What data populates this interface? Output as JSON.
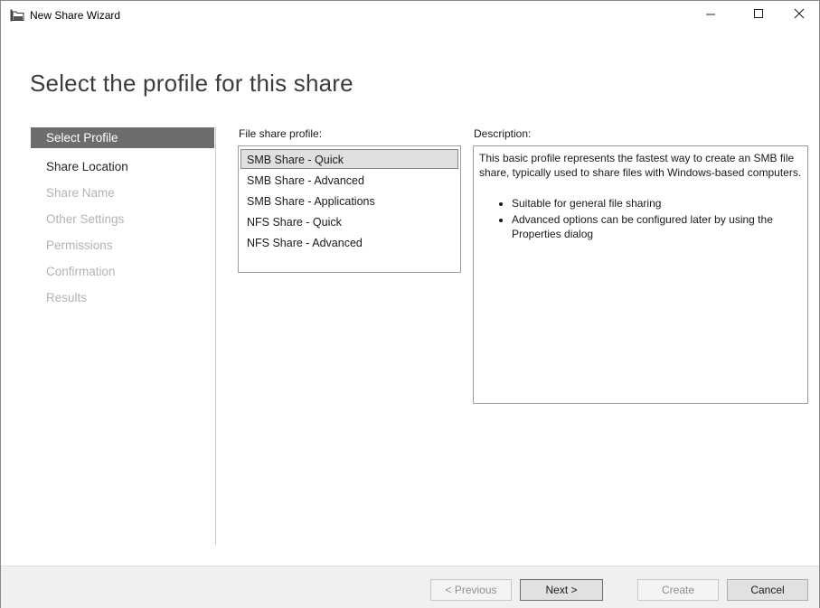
{
  "window": {
    "title": "New Share Wizard",
    "icons": {
      "app": "share-folder-icon",
      "minimize": "minimize-icon",
      "maximize": "maximize-icon",
      "close": "close-icon"
    }
  },
  "page": {
    "title": "Select the profile for this share"
  },
  "nav": {
    "items": [
      {
        "label": "Select Profile",
        "state": "active"
      },
      {
        "label": "Share Location",
        "state": "enabled"
      },
      {
        "label": "Share Name",
        "state": "disabled"
      },
      {
        "label": "Other Settings",
        "state": "disabled"
      },
      {
        "label": "Permissions",
        "state": "disabled"
      },
      {
        "label": "Confirmation",
        "state": "disabled"
      },
      {
        "label": "Results",
        "state": "disabled"
      }
    ]
  },
  "profile": {
    "label": "File share profile:",
    "items": [
      {
        "label": "SMB Share - Quick",
        "selected": true
      },
      {
        "label": "SMB Share - Advanced",
        "selected": false
      },
      {
        "label": "SMB Share - Applications",
        "selected": false
      },
      {
        "label": "NFS Share - Quick",
        "selected": false
      },
      {
        "label": "NFS Share - Advanced",
        "selected": false
      }
    ]
  },
  "description": {
    "label": "Description:",
    "text": "This basic profile represents the fastest way to create an SMB file share, typically used to share files with Windows-based computers.",
    "bullets": [
      "Suitable for general file sharing",
      "Advanced options can be configured later by using the Properties dialog"
    ]
  },
  "buttons": {
    "previous": "< Previous",
    "next": "Next >",
    "create": "Create",
    "cancel": "Cancel"
  }
}
